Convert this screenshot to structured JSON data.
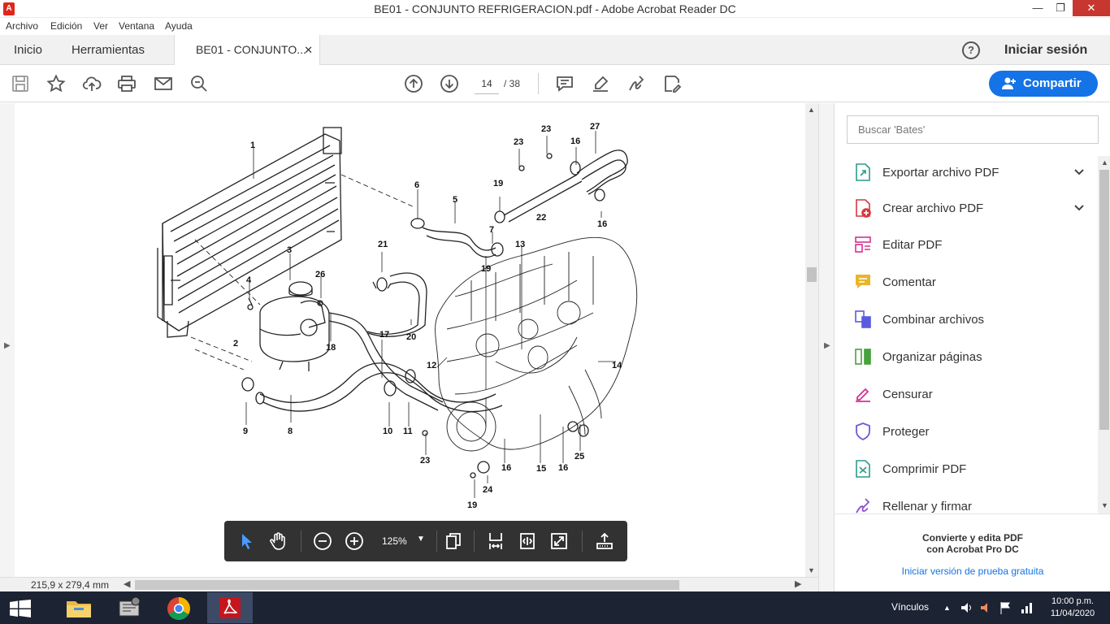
{
  "window": {
    "title": "BE01 - CONJUNTO REFRIGERACION.pdf - Adobe Acrobat Reader DC",
    "min": "—",
    "max": "❐",
    "close": "✕"
  },
  "menu": [
    "Archivo",
    "Edición",
    "Ver",
    "Ventana",
    "Ayuda"
  ],
  "tabs": {
    "home": "Inicio",
    "tools": "Herramientas",
    "document": "BE01 - CONJUNTO...",
    "close": "✕",
    "help": "?",
    "signin": "Iniciar sesión"
  },
  "toolbar": {
    "page_current": "14",
    "page_total": "/ 38",
    "share_label": "Compartir",
    "icons": [
      "save-icon",
      "bookmark-star-icon",
      "upload-icon",
      "print-icon",
      "email-icon",
      "zoom-search-icon",
      "page-up-icon",
      "page-down-icon",
      "comment-icon",
      "highlight-pen-icon",
      "sign-icon",
      "fill-sign-icon"
    ]
  },
  "floating_toolbar": {
    "zoom": "125%",
    "icons": [
      "select-cursor-icon",
      "hand-tool-icon",
      "zoom-out-icon",
      "zoom-in-icon",
      "page-layout-icon",
      "fit-width-icon",
      "fit-page-icon",
      "full-screen-icon",
      "read-mode-icon"
    ]
  },
  "status": {
    "page_size": "215,9 x 279,4 mm"
  },
  "right_pane": {
    "search_placeholder": "Buscar 'Bates'",
    "tools": [
      {
        "label": "Exportar archivo PDF",
        "icon": "export-pdf-icon",
        "color": "#2c9b8a",
        "expandable": true
      },
      {
        "label": "Crear archivo PDF",
        "icon": "create-pdf-icon",
        "color": "#d7373f",
        "expandable": true
      },
      {
        "label": "Editar PDF",
        "icon": "edit-pdf-icon",
        "color": "#d5318f",
        "expandable": false
      },
      {
        "label": "Comentar",
        "icon": "comment-tool-icon",
        "color": "#e8b52b",
        "expandable": false
      },
      {
        "label": "Combinar archivos",
        "icon": "combine-files-icon",
        "color": "#5a5ae0",
        "expandable": false
      },
      {
        "label": "Organizar páginas",
        "icon": "organize-pages-icon",
        "color": "#46a23b",
        "expandable": false
      },
      {
        "label": "Censurar",
        "icon": "redact-icon",
        "color": "#d5318f",
        "expandable": false
      },
      {
        "label": "Proteger",
        "icon": "protect-shield-icon",
        "color": "#6a5bd6",
        "expandable": false
      },
      {
        "label": "Comprimir PDF",
        "icon": "compress-pdf-icon",
        "color": "#2c9b8a",
        "expandable": false
      },
      {
        "label": "Rellenar y firmar",
        "icon": "fill-sign-tool-icon",
        "color": "#8a4fd6",
        "expandable": false
      }
    ],
    "promo_line1": "Convierte y edita PDF",
    "promo_line2": "con Acrobat Pro DC",
    "promo_link": "Iniciar versión de prueba gratuita"
  },
  "diagram_labels": [
    {
      "text": "1"
    },
    {
      "text": "2"
    },
    {
      "text": "3"
    },
    {
      "text": "4"
    },
    {
      "text": "5"
    },
    {
      "text": "6"
    },
    {
      "text": "7"
    },
    {
      "text": "8"
    },
    {
      "text": "9"
    },
    {
      "text": "10"
    },
    {
      "text": "11"
    },
    {
      "text": "12"
    },
    {
      "text": "13"
    },
    {
      "text": "14"
    },
    {
      "text": "15"
    },
    {
      "text": "16"
    },
    {
      "text": "16"
    },
    {
      "text": "16"
    },
    {
      "text": "16"
    },
    {
      "text": "17"
    },
    {
      "text": "18"
    },
    {
      "text": "19"
    },
    {
      "text": "19"
    },
    {
      "text": "19"
    },
    {
      "text": "20"
    },
    {
      "text": "21"
    },
    {
      "text": "22"
    },
    {
      "text": "23"
    },
    {
      "text": "23"
    },
    {
      "text": "23"
    },
    {
      "text": "24"
    },
    {
      "text": "25"
    },
    {
      "text": "26"
    },
    {
      "text": "27"
    }
  ],
  "taskbar": {
    "apps": [
      "file-explorer-icon",
      "control-panel-icon",
      "chrome-icon",
      "acrobat-icon"
    ],
    "links": "Vínculos",
    "time": "10:00 p.m.",
    "date": "11/04/2020"
  }
}
